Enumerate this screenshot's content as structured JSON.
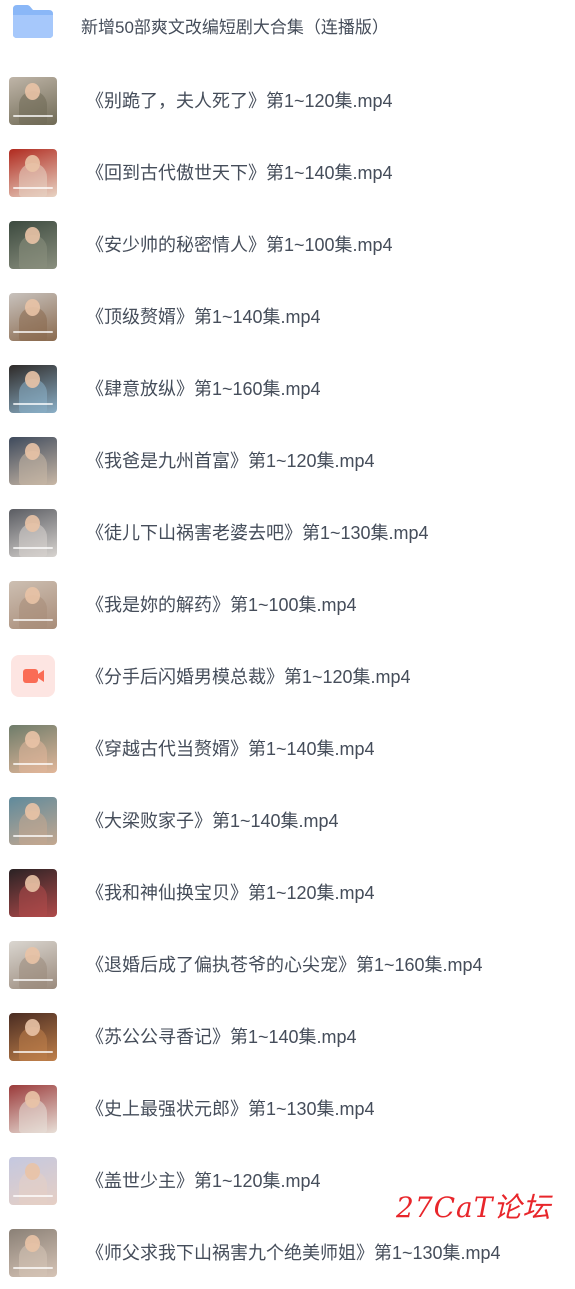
{
  "folder": {
    "name": "新增50部爽文改编短剧大合集（连播版）",
    "icon": "folder-icon",
    "color": "#8ab7f7"
  },
  "files": [
    {
      "name": "《别跪了，夫人死了》第1~120集.mp4",
      "thumb_colors": [
        "#bfb5a8",
        "#6f6a55"
      ]
    },
    {
      "name": "《回到古代傲世天下》第1~140集.mp4",
      "thumb_colors": [
        "#b02a1f",
        "#e8d4c4"
      ]
    },
    {
      "name": "《安少帅的秘密情人》第1~100集.mp4",
      "thumb_colors": [
        "#3c4a3f",
        "#8a8f7e"
      ]
    },
    {
      "name": "《顶级赘婿》第1~140集.mp4",
      "thumb_colors": [
        "#c8c2bd",
        "#8a6a4e"
      ]
    },
    {
      "name": "《肆意放纵》第1~160集.mp4",
      "thumb_colors": [
        "#2e2a28",
        "#8bb0c8"
      ]
    },
    {
      "name": "《我爸是九州首富》第1~120集.mp4",
      "thumb_colors": [
        "#3e4a5c",
        "#c9b8a6"
      ]
    },
    {
      "name": "《徒儿下山祸害老婆去吧》第1~130集.mp4",
      "thumb_colors": [
        "#5a5c62",
        "#d8d4d0"
      ]
    },
    {
      "name": "《我是妳的解药》第1~100集.mp4",
      "thumb_colors": [
        "#cdbfb2",
        "#a88c78"
      ]
    },
    {
      "name": "《分手后闪婚男模总裁》第1~120集.mp4",
      "thumb_colors": [
        "#fde5e2",
        "#fa6c55"
      ],
      "is_icon": true
    },
    {
      "name": "《穿越古代当赘婿》第1~140集.mp4",
      "thumb_colors": [
        "#6e7c6a",
        "#e2b79a"
      ]
    },
    {
      "name": "《大梁败家子》第1~140集.mp4",
      "thumb_colors": [
        "#5f8a9c",
        "#c4a890"
      ]
    },
    {
      "name": "《我和神仙换宝贝》第1~120集.mp4",
      "thumb_colors": [
        "#2a2224",
        "#b04a4a"
      ]
    },
    {
      "name": "《退婚后成了偏执苍爷的心尖宠》第1~160集.mp4",
      "thumb_colors": [
        "#dad6d0",
        "#9a8a7c"
      ]
    },
    {
      "name": "《苏公公寻香记》第1~140集.mp4",
      "thumb_colors": [
        "#4a2c22",
        "#c0804a"
      ]
    },
    {
      "name": "《史上最强状元郎》第1~130集.mp4",
      "thumb_colors": [
        "#9a3a3a",
        "#e8e0d8"
      ]
    },
    {
      "name": "《盖世少主》第1~120集.mp4",
      "thumb_colors": [
        "#c4c8e0",
        "#e6cfc4"
      ]
    },
    {
      "name": "《师父求我下山祸害九个绝美师姐》第1~130集.mp4",
      "thumb_colors": [
        "#8a8076",
        "#d6c4b6"
      ]
    }
  ],
  "video_icon": {
    "name": "video-camera-icon",
    "color": "#fa6c55"
  },
  "watermark": "27CaT论坛"
}
